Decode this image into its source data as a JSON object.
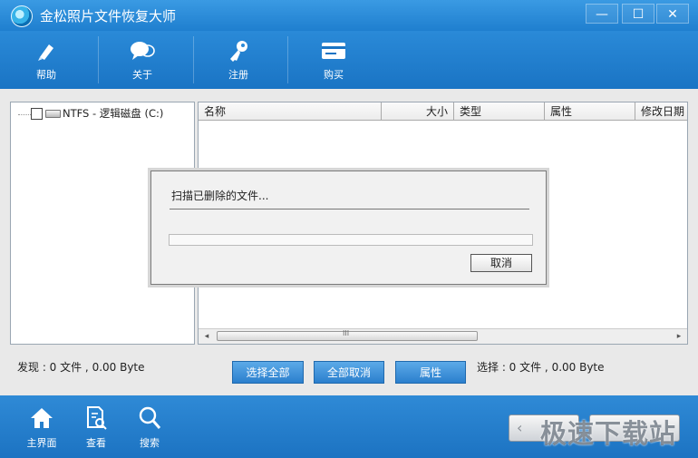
{
  "window": {
    "title": "金松照片文件恢复大师",
    "controls": {
      "minimize": "—",
      "maximize": "☐",
      "close": "✕"
    }
  },
  "toolbar": {
    "items": [
      {
        "label": "帮助",
        "icon": "pen-icon"
      },
      {
        "label": "关于",
        "icon": "chat-bubbles-icon"
      },
      {
        "label": "注册",
        "icon": "key-icon"
      },
      {
        "label": "购买",
        "icon": "card-icon"
      }
    ]
  },
  "tree": {
    "root_label": "NTFS - 逻辑磁盘 (C:)"
  },
  "file_list": {
    "columns": [
      "名称",
      "大小",
      "类型",
      "属性",
      "修改日期"
    ],
    "rows": [],
    "scroll_arrows": {
      "left": "◂",
      "right": "▸"
    },
    "thumb_grip": "III"
  },
  "scan_dialog": {
    "message": "扫描已删除的文件...",
    "progress": 0,
    "cancel_label": "取消"
  },
  "status": {
    "found": "发现 : 0 文件 , 0.00 Byte",
    "selected": "选择 : 0 文件 , 0.00 Byte"
  },
  "actions": {
    "select_all": "选择全部",
    "deselect_all": "全部取消",
    "properties": "属性"
  },
  "bottom_nav": {
    "items": [
      {
        "label": "主界面",
        "icon": "home-icon"
      },
      {
        "label": "查看",
        "icon": "document-search-icon"
      },
      {
        "label": "搜索",
        "icon": "magnifier-icon"
      }
    ],
    "back_glyph": "‹"
  },
  "watermark": "极速下载站"
}
